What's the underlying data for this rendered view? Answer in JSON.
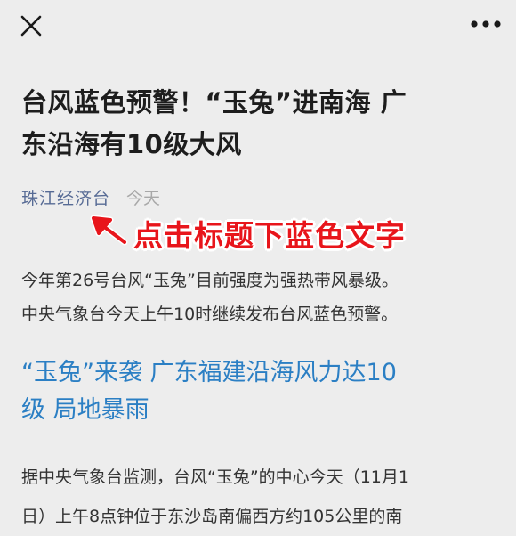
{
  "nav": {
    "close_icon": "close-icon",
    "more_icon": "more-horizontal-icon"
  },
  "article": {
    "title_line1": "台风蓝色预警！“玉兔”进南海 广",
    "title_line2": "东沿海有10级大风",
    "account_name": "珠江经济台",
    "date": "今天",
    "lead_line1": "今年第26号台风“玉兔”目前强度为强热带风暴级。",
    "lead_line2": "中央气象台今天上午10时继续发布台风蓝色预警。",
    "subhead_line1": "“玉兔”来袭 广东福建沿海风力达10",
    "subhead_line2": "级 局地暴雨",
    "body_line1": "据中央气象台监测，台风“玉兔”的中心今天（11月1",
    "body_line2": "日）上午8点钟位于东沙岛南偏西方约105公里的南"
  },
  "annotation": {
    "text": "点击标题下蓝色文字",
    "color": "#e8151b",
    "arrow_icon": "red-arrow-icon"
  },
  "colors": {
    "background": "#ededed",
    "account_link": "#576b95",
    "subhead": "#2b7fc4"
  }
}
